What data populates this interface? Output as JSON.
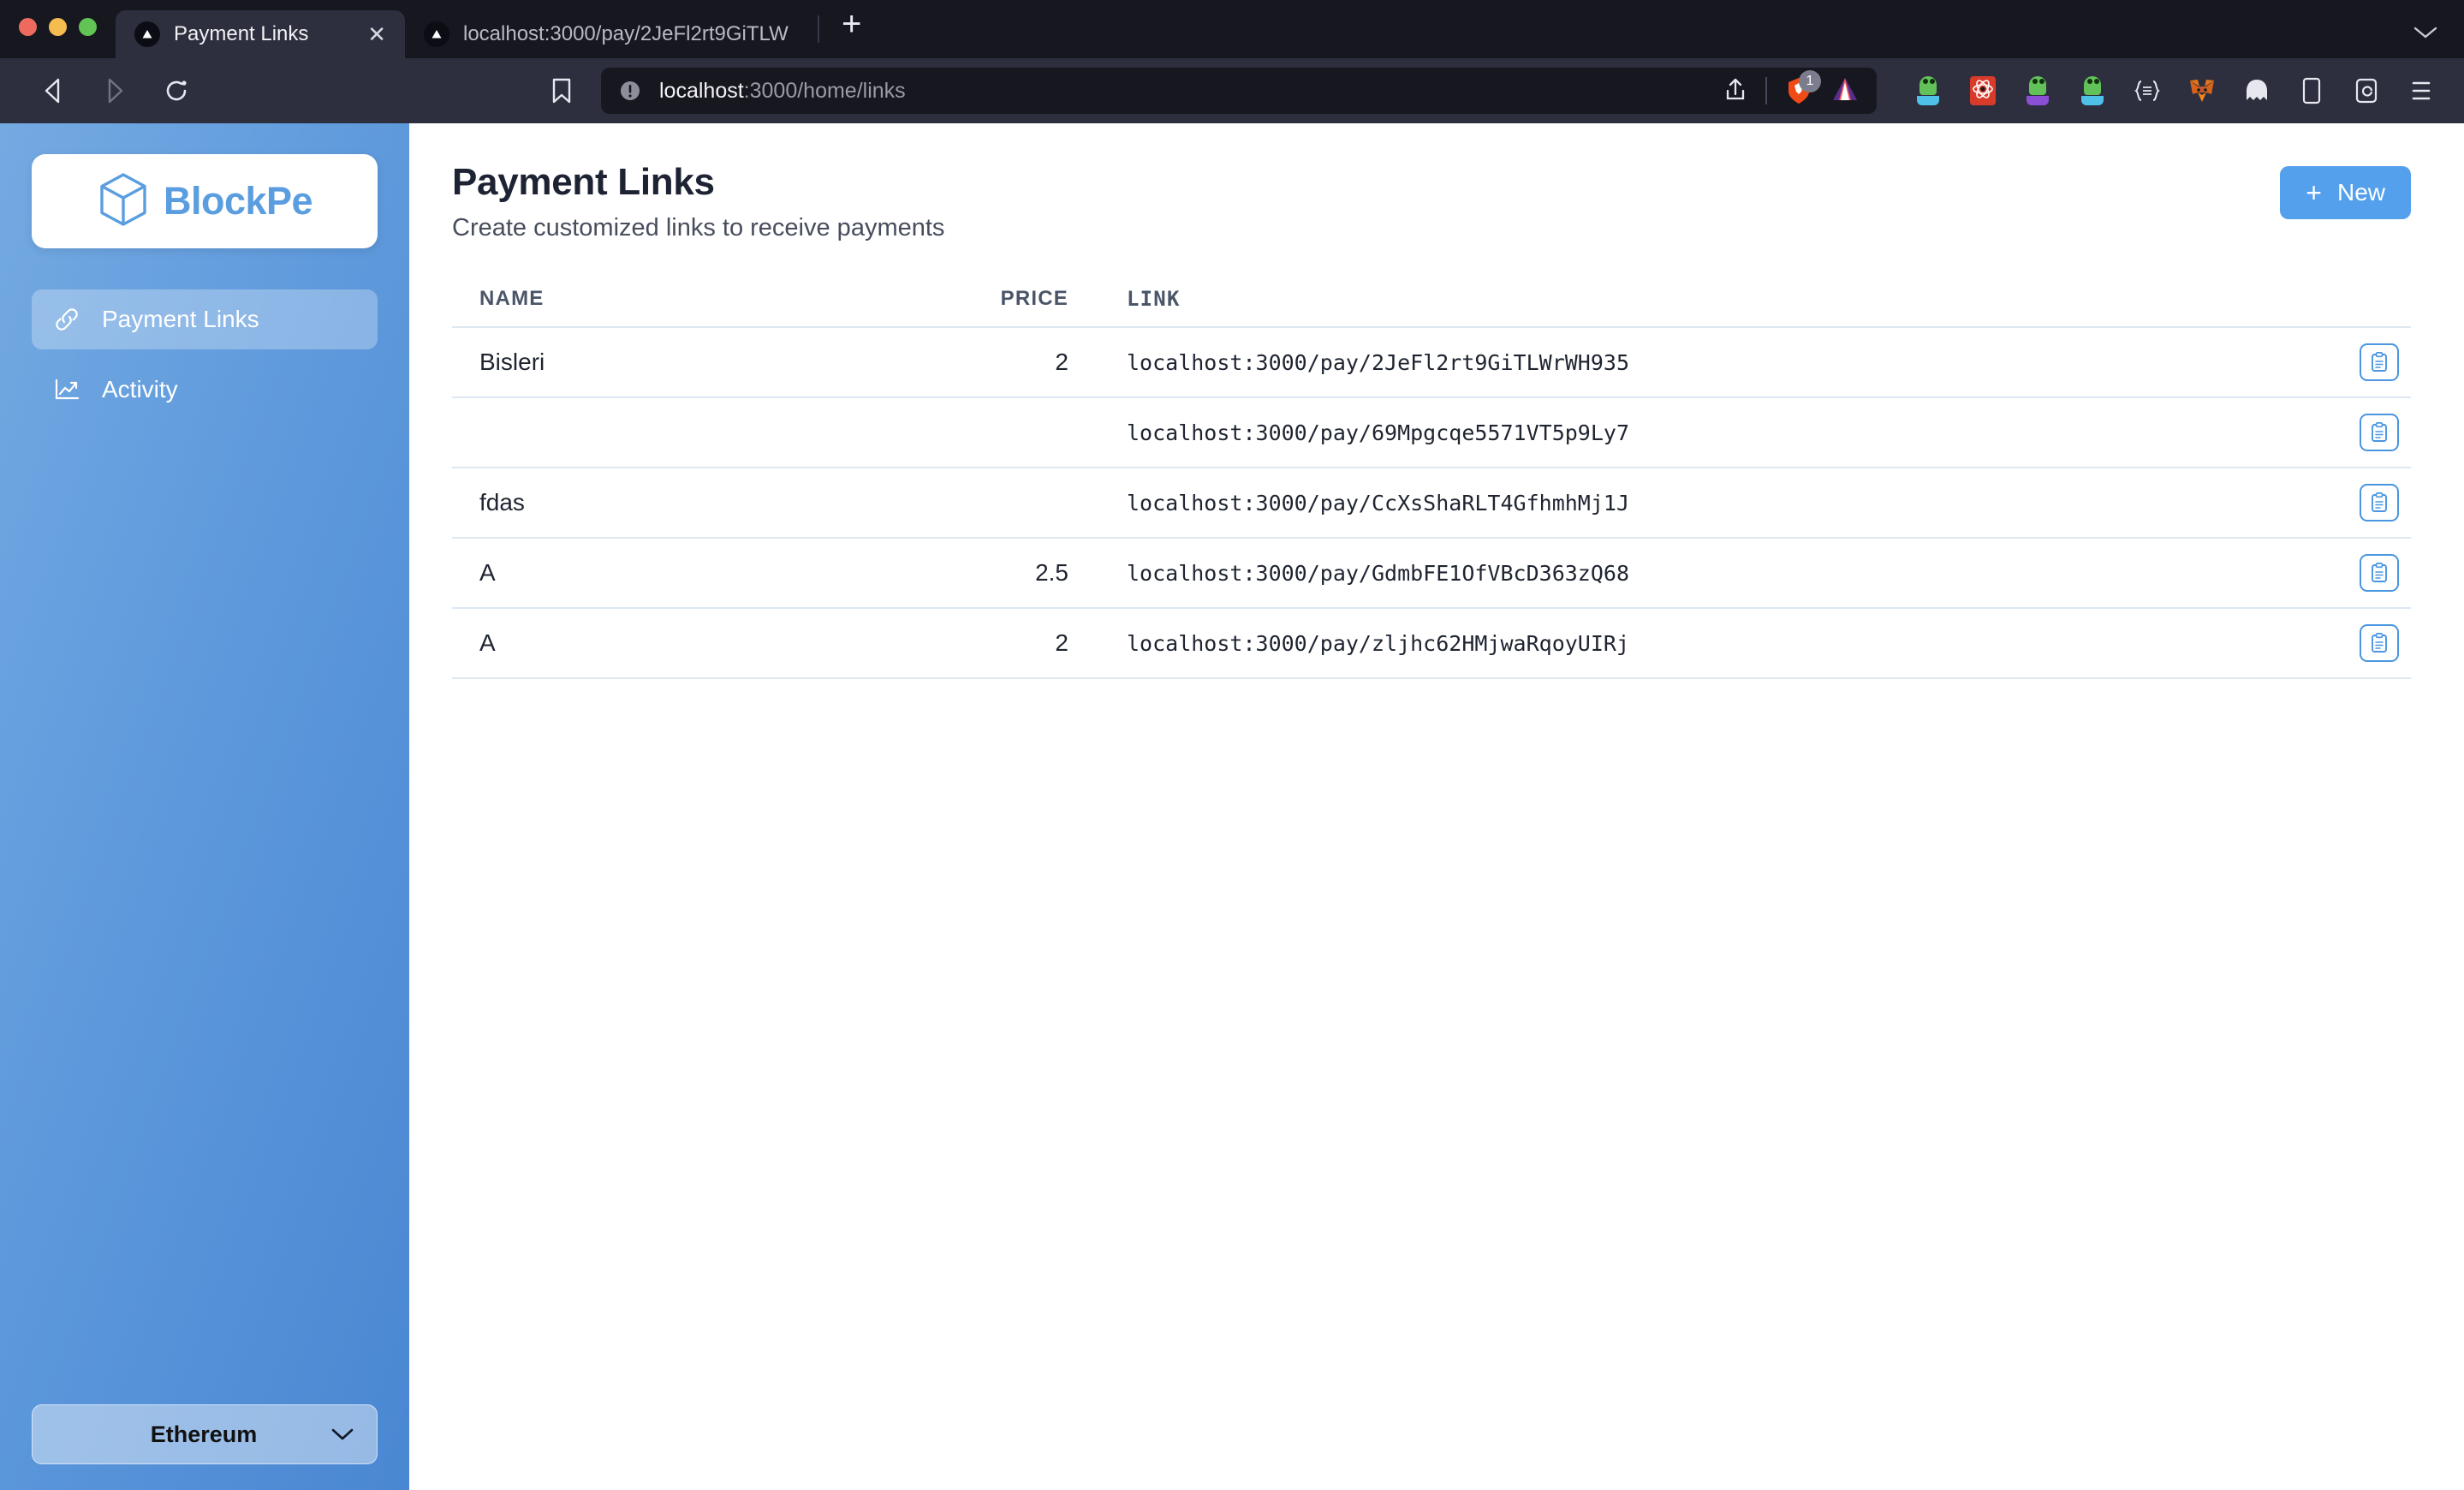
{
  "browser": {
    "tabs": [
      {
        "title": "Payment Links",
        "active": true,
        "close_label": "✕"
      },
      {
        "title": "localhost:3000/pay/2JeFl2rt9GiTLW",
        "active": false
      }
    ],
    "new_tab_label": "+",
    "url": {
      "host": "localhost",
      "path": ":3000/home/links"
    },
    "shield_badge_count": "1",
    "extensions": [
      "frog-extension-icon",
      "atom-extension-icon",
      "frog-purple-extension-icon",
      "frog-blue-extension-icon",
      "code-extension-icon",
      "metamask-fox-icon",
      "phantom-ghost-icon",
      "reader-mode-icon",
      "wallet-extension-icon"
    ],
    "menu_label": "☰"
  },
  "sidebar": {
    "logo_text": "BlockPe",
    "items": [
      {
        "label": "Payment Links",
        "icon": "link-icon",
        "active": true
      },
      {
        "label": "Activity",
        "icon": "trending-up-icon",
        "active": false
      }
    ],
    "chain": {
      "selected": "Ethereum",
      "chevron": "chevron-down-icon"
    }
  },
  "main": {
    "title": "Payment Links",
    "subtitle": "Create customized links to receive payments",
    "new_button": {
      "plus": "+",
      "label": "New"
    },
    "table": {
      "columns": [
        "NAME",
        "PRICE",
        "LINK"
      ],
      "rows": [
        {
          "name": "Bisleri",
          "price": "2",
          "link": "localhost:3000/pay/2JeFl2rt9GiTLWrWH935"
        },
        {
          "name": "",
          "price": "",
          "link": "localhost:3000/pay/69Mpgcqe5571VT5p9Ly7"
        },
        {
          "name": "fdas",
          "price": "",
          "link": "localhost:3000/pay/CcXsShaRLT4GfhmhMj1J"
        },
        {
          "name": "A",
          "price": "2.5",
          "link": "localhost:3000/pay/GdmbFE1OfVBcD363zQ68"
        },
        {
          "name": "A",
          "price": "2",
          "link": "localhost:3000/pay/zljhc62HMjwaRqoyUIRj"
        }
      ],
      "copy_icon": "clipboard-icon"
    }
  },
  "colors": {
    "accent": "#54a0ec",
    "sidebar_top": "#74aae2",
    "sidebar_bottom": "#4a87d2",
    "chrome": "#2d2f3e",
    "tabstrip": "#17171f",
    "logo_blue": "#5b9ee0",
    "row_border": "#dde8f3"
  }
}
